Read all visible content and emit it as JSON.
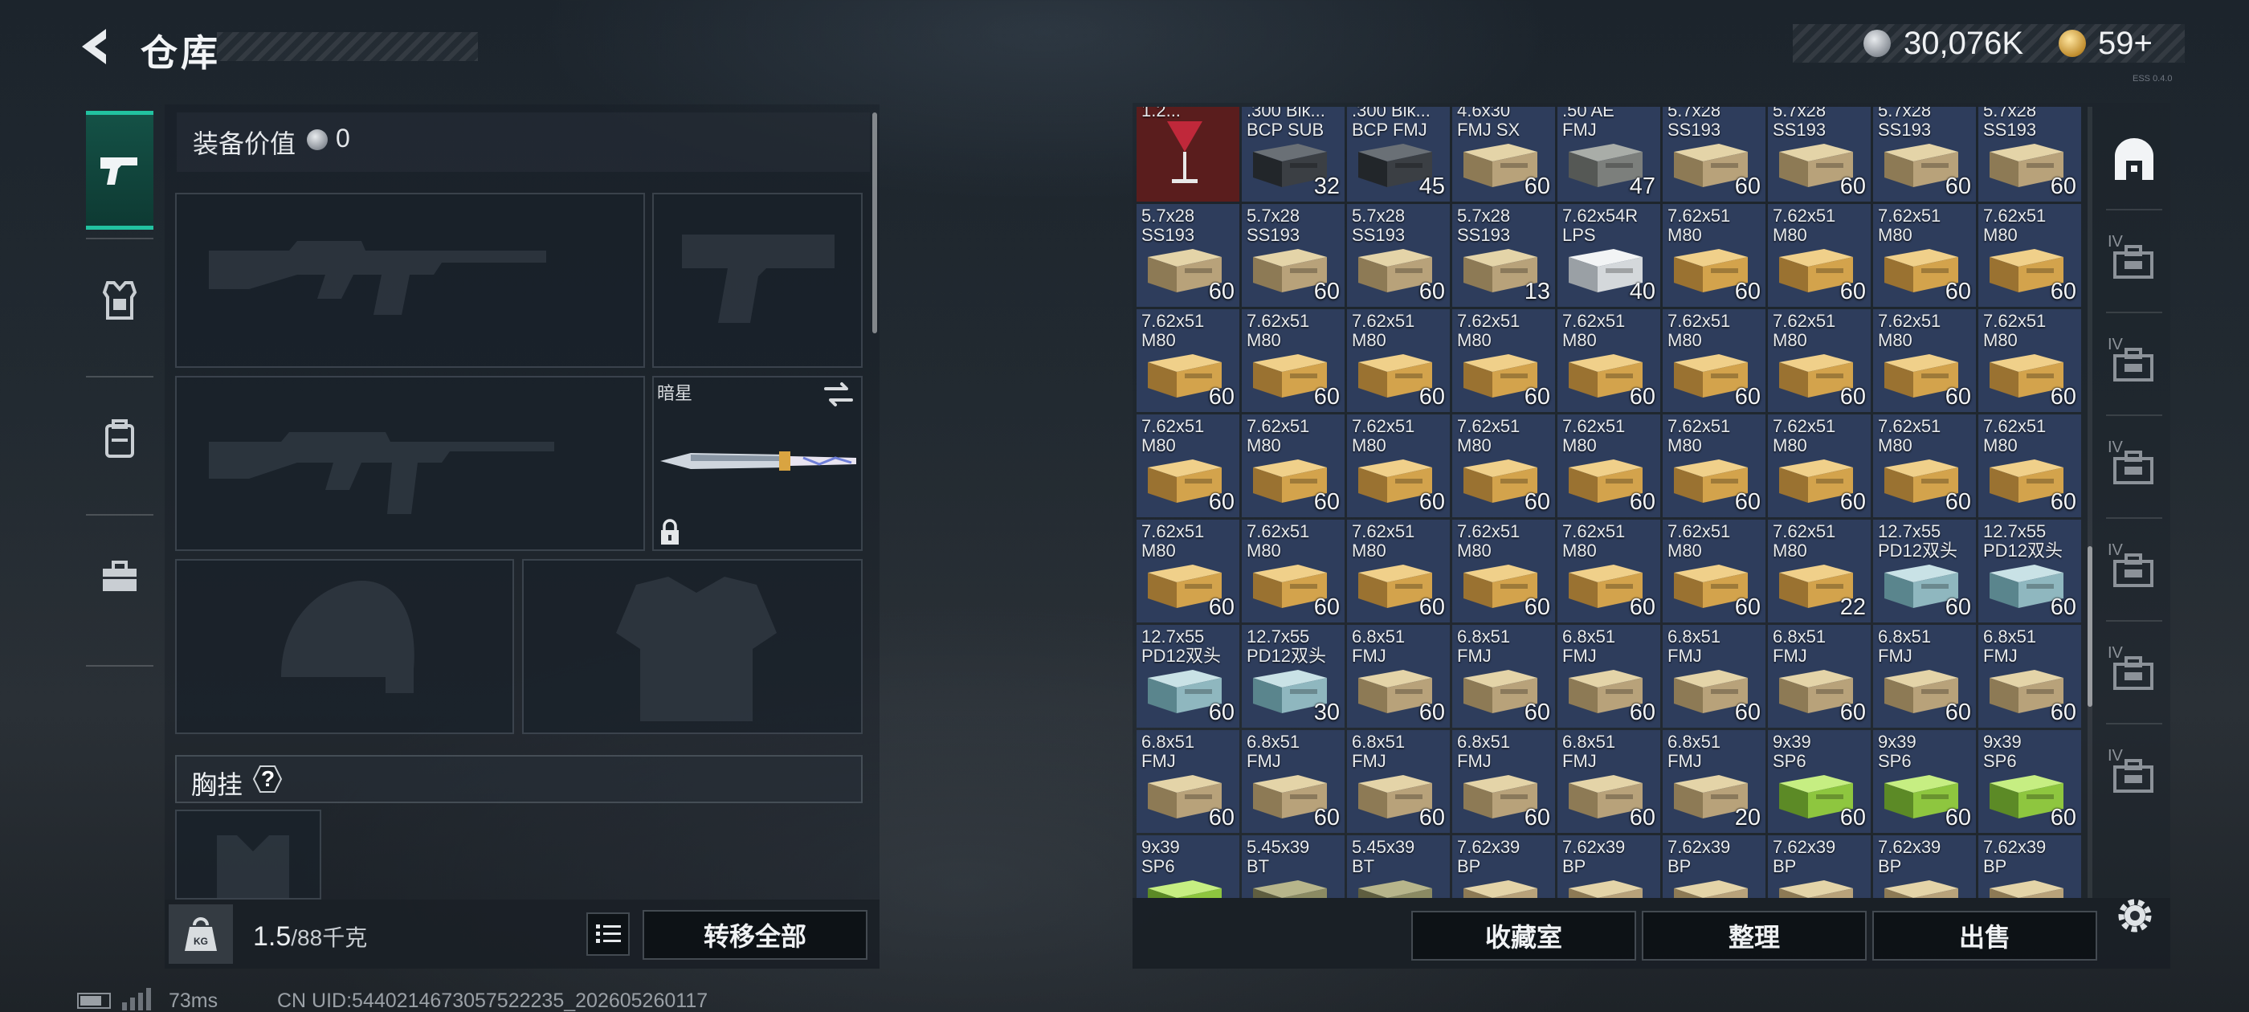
{
  "header": {
    "title": "仓库",
    "currency_value": "30,076K",
    "coupon_value": "59+",
    "tiny_text": "ESS 0.4.0"
  },
  "loadout": {
    "equip_value_label": "装备价值",
    "equip_value": "0",
    "melee_name": "暗星",
    "chest_label": "胸挂",
    "help_glyph": "?",
    "weight_current": "1.5",
    "weight_max": "/88千克",
    "transfer_all_label": "转移全部"
  },
  "inventory": {
    "buttons": {
      "collection": "收藏室",
      "sort": "整理",
      "sell": "出售"
    },
    "cells": [
      {
        "name": "1.2...",
        "count": "",
        "type": "drink"
      },
      {
        "name": ".300 Blk...\nBCP SUB",
        "count": "32",
        "type": "ammo-black"
      },
      {
        "name": ".300 Blk...\nBCP FMJ",
        "count": "45",
        "type": "ammo-black"
      },
      {
        "name": "4.6x30\nFMJ SX",
        "count": "60",
        "type": "ammo-tan"
      },
      {
        "name": ".50 AE\nFMJ",
        "count": "47",
        "type": "ammo-dark"
      },
      {
        "name": "5.7x28\nSS193",
        "count": "60",
        "type": "ammo-tan"
      },
      {
        "name": "5.7x28\nSS193",
        "count": "60",
        "type": "ammo-tan"
      },
      {
        "name": "5.7x28\nSS193",
        "count": "60",
        "type": "ammo-tan"
      },
      {
        "name": "5.7x28\nSS193",
        "count": "60",
        "type": "ammo-tan"
      },
      {
        "name": "5.7x28\nSS193",
        "count": "60",
        "type": "ammo-tan"
      },
      {
        "name": "5.7x28\nSS193",
        "count": "60",
        "type": "ammo-tan"
      },
      {
        "name": "5.7x28\nSS193",
        "count": "60",
        "type": "ammo-tan"
      },
      {
        "name": "5.7x28\nSS193",
        "count": "13",
        "type": "ammo-tan"
      },
      {
        "name": "7.62x54R\nLPS",
        "count": "40",
        "type": "ammo-white"
      },
      {
        "name": "7.62x51\nM80",
        "count": "60",
        "type": "ammo-gold"
      },
      {
        "name": "7.62x51\nM80",
        "count": "60",
        "type": "ammo-gold"
      },
      {
        "name": "7.62x51\nM80",
        "count": "60",
        "type": "ammo-gold"
      },
      {
        "name": "7.62x51\nM80",
        "count": "60",
        "type": "ammo-gold"
      },
      {
        "name": "7.62x51\nM80",
        "count": "60",
        "type": "ammo-gold"
      },
      {
        "name": "7.62x51\nM80",
        "count": "60",
        "type": "ammo-gold"
      },
      {
        "name": "7.62x51\nM80",
        "count": "60",
        "type": "ammo-gold"
      },
      {
        "name": "7.62x51\nM80",
        "count": "60",
        "type": "ammo-gold"
      },
      {
        "name": "7.62x51\nM80",
        "count": "60",
        "type": "ammo-gold"
      },
      {
        "name": "7.62x51\nM80",
        "count": "60",
        "type": "ammo-gold"
      },
      {
        "name": "7.62x51\nM80",
        "count": "60",
        "type": "ammo-gold"
      },
      {
        "name": "7.62x51\nM80",
        "count": "60",
        "type": "ammo-gold"
      },
      {
        "name": "7.62x51\nM80",
        "count": "60",
        "type": "ammo-gold"
      },
      {
        "name": "7.62x51\nM80",
        "count": "60",
        "type": "ammo-gold"
      },
      {
        "name": "7.62x51\nM80",
        "count": "60",
        "type": "ammo-gold"
      },
      {
        "name": "7.62x51\nM80",
        "count": "60",
        "type": "ammo-gold"
      },
      {
        "name": "7.62x51\nM80",
        "count": "60",
        "type": "ammo-gold"
      },
      {
        "name": "7.62x51\nM80",
        "count": "60",
        "type": "ammo-gold"
      },
      {
        "name": "7.62x51\nM80",
        "count": "60",
        "type": "ammo-gold"
      },
      {
        "name": "7.62x51\nM80",
        "count": "60",
        "type": "ammo-gold"
      },
      {
        "name": "7.62x51\nM80",
        "count": "60",
        "type": "ammo-gold"
      },
      {
        "name": "7.62x51\nM80",
        "count": "60",
        "type": "ammo-gold"
      },
      {
        "name": "7.62x51\nM80",
        "count": "60",
        "type": "ammo-gold"
      },
      {
        "name": "7.62x51\nM80",
        "count": "60",
        "type": "ammo-gold"
      },
      {
        "name": "7.62x51\nM80",
        "count": "60",
        "type": "ammo-gold"
      },
      {
        "name": "7.62x51\nM80",
        "count": "60",
        "type": "ammo-gold"
      },
      {
        "name": "7.62x51\nM80",
        "count": "60",
        "type": "ammo-gold"
      },
      {
        "name": "7.62x51\nM80",
        "count": "60",
        "type": "ammo-gold"
      },
      {
        "name": "7.62x51\nM80",
        "count": "22",
        "type": "ammo-gold"
      },
      {
        "name": "12.7x55\nPD12双头",
        "count": "60",
        "type": "ammo-teal"
      },
      {
        "name": "12.7x55\nPD12双头",
        "count": "60",
        "type": "ammo-teal"
      },
      {
        "name": "12.7x55\nPD12双头",
        "count": "60",
        "type": "ammo-teal"
      },
      {
        "name": "12.7x55\nPD12双头",
        "count": "30",
        "type": "ammo-teal"
      },
      {
        "name": "6.8x51\nFMJ",
        "count": "60",
        "type": "ammo-tan"
      },
      {
        "name": "6.8x51\nFMJ",
        "count": "60",
        "type": "ammo-tan"
      },
      {
        "name": "6.8x51\nFMJ",
        "count": "60",
        "type": "ammo-tan"
      },
      {
        "name": "6.8x51\nFMJ",
        "count": "60",
        "type": "ammo-tan"
      },
      {
        "name": "6.8x51\nFMJ",
        "count": "60",
        "type": "ammo-tan"
      },
      {
        "name": "6.8x51\nFMJ",
        "count": "60",
        "type": "ammo-tan"
      },
      {
        "name": "6.8x51\nFMJ",
        "count": "60",
        "type": "ammo-tan"
      },
      {
        "name": "6.8x51\nFMJ",
        "count": "60",
        "type": "ammo-tan"
      },
      {
        "name": "6.8x51\nFMJ",
        "count": "60",
        "type": "ammo-tan"
      },
      {
        "name": "6.8x51\nFMJ",
        "count": "60",
        "type": "ammo-tan"
      },
      {
        "name": "6.8x51\nFMJ",
        "count": "60",
        "type": "ammo-tan"
      },
      {
        "name": "6.8x51\nFMJ",
        "count": "60",
        "type": "ammo-tan"
      },
      {
        "name": "6.8x51\nFMJ",
        "count": "20",
        "type": "ammo-tan"
      },
      {
        "name": "9x39\nSP6",
        "count": "60",
        "type": "ammo-green"
      },
      {
        "name": "9x39\nSP6",
        "count": "60",
        "type": "ammo-green"
      },
      {
        "name": "9x39\nSP6",
        "count": "60",
        "type": "ammo-green"
      },
      {
        "name": "9x39\nSP6",
        "count": "",
        "type": "ammo-green"
      },
      {
        "name": "5.45x39\nBT",
        "count": "",
        "type": "ammo-olive"
      },
      {
        "name": "5.45x39\nBT",
        "count": "",
        "type": "ammo-olive"
      },
      {
        "name": "7.62x39\nBP",
        "count": "",
        "type": "ammo-tan"
      },
      {
        "name": "7.62x39\nBP",
        "count": "",
        "type": "ammo-tan"
      },
      {
        "name": "7.62x39\nBP",
        "count": "",
        "type": "ammo-tan"
      },
      {
        "name": "7.62x39\nBP",
        "count": "",
        "type": "ammo-tan"
      },
      {
        "name": "7.62x39\nBP",
        "count": "",
        "type": "ammo-tan"
      },
      {
        "name": "7.62x39\nBP",
        "count": "",
        "type": "ammo-tan"
      }
    ]
  },
  "right_rail": [
    {
      "icon": "storage-icon",
      "label": ""
    },
    {
      "icon": "case-icon",
      "label": "IV"
    },
    {
      "icon": "folder-icon",
      "label": "IV"
    },
    {
      "icon": "camera-case-icon",
      "label": "IV"
    },
    {
      "icon": "medkit-icon",
      "label": "IV"
    },
    {
      "icon": "case-icon",
      "label": "IV"
    },
    {
      "icon": "case-icon",
      "label": "IV"
    }
  ],
  "status": {
    "ping": "73ms",
    "uid": "CN UID:5440214673057522235_202605260117"
  },
  "colors": {
    "accent": "#22c2a0",
    "cell_bg": "#2e3d5c",
    "drink_bg": "#5a1d1d"
  }
}
